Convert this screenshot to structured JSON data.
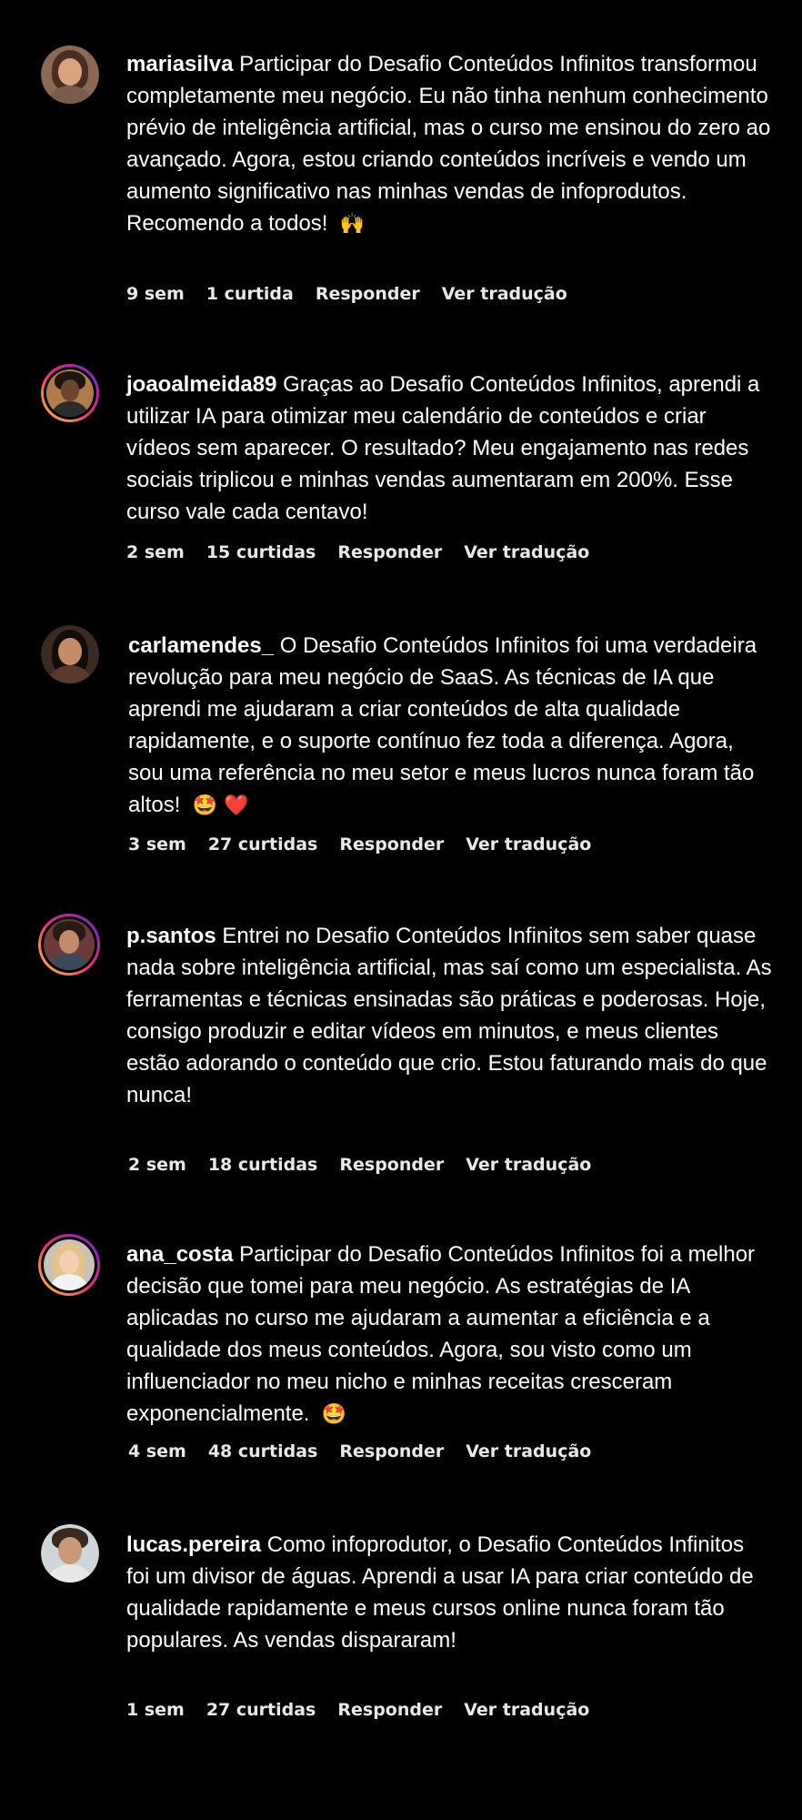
{
  "comments": [
    {
      "username": "mariasilva",
      "text": "Participar do Desafio Conteúdos Infinitos transformou completamente meu negócio. Eu não tinha nenhum conhecimento prévio de inteligência artificial, mas o curso me ensinou do zero ao avançado. Agora, estou criando conteúdos incríveis e vendo um aumento significativo nas minhas vendas de infoprodutos. Recomendo a todos!",
      "emoji": "🙌",
      "time": "9 sem",
      "likes": "1 curtida",
      "reply": "Responder",
      "translate": "Ver tradução"
    },
    {
      "username": "joaoalmeida89",
      "text": "Graças ao Desafio Conteúdos Infinitos, aprendi a utilizar IA para otimizar meu calendário de conteúdos e criar vídeos sem aparecer. O resultado? Meu engajamento nas redes sociais triplicou e minhas vendas aumentaram em 200%. Esse curso vale cada centavo!",
      "emoji": "",
      "time": "2 sem",
      "likes": "15 curtidas",
      "reply": "Responder",
      "translate": "Ver tradução"
    },
    {
      "username": "carlamendes_",
      "text": "O Desafio Conteúdos Infinitos foi uma verdadeira revolução para meu negócio de SaaS. As técnicas de IA que aprendi me ajudaram a criar conteúdos de alta qualidade rapidamente, e o suporte contínuo fez toda a diferença. Agora, sou uma referência no meu setor e meus lucros nunca foram tão altos!",
      "emoji": "🤩 ❤️",
      "time": "3 sem",
      "likes": "27 curtidas",
      "reply": "Responder",
      "translate": "Ver tradução"
    },
    {
      "username": "p.santos",
      "text": "Entrei no Desafio Conteúdos Infinitos sem saber quase nada sobre inteligência artificial, mas saí como um especialista. As ferramentas e técnicas ensinadas são práticas e poderosas. Hoje, consigo produzir e editar vídeos em minutos, e meus clientes estão adorando o conteúdo que crio. Estou faturando mais do que nunca!",
      "emoji": "",
      "time": "2 sem",
      "likes": "18 curtidas",
      "reply": "Responder",
      "translate": "Ver tradução"
    },
    {
      "username": "ana_costa",
      "text": "Participar do Desafio Conteúdos Infinitos foi a melhor decisão que tomei para meu negócio. As estratégias de IA aplicadas no curso me ajudaram a aumentar a eficiência e a qualidade dos meus conteúdos. Agora, sou visto como um influenciador no meu nicho e minhas receitas cresceram exponencialmente.",
      "emoji": "🤩",
      "time": "4 sem",
      "likes": "48 curtidas",
      "reply": "Responder",
      "translate": "Ver tradução"
    },
    {
      "username": "lucas.pereira",
      "text": "Como infoprodutor, o Desafio Conteúdos Infinitos foi um divisor de águas. Aprendi a usar IA para criar conteúdo de qualidade rapidamente e meus cursos online nunca foram tão populares. As vendas dispararam!",
      "emoji": "",
      "time": "1 sem",
      "likes": "27 curtidas",
      "reply": "Responder",
      "translate": "Ver tradução"
    }
  ]
}
